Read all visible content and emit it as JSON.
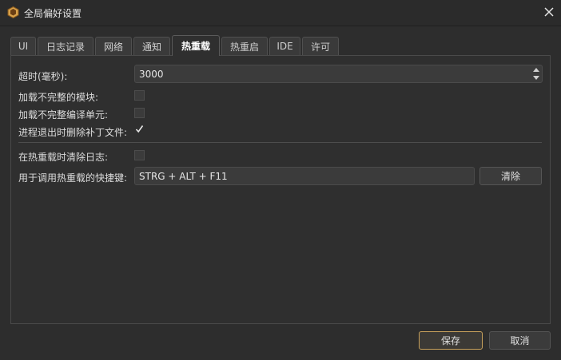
{
  "window": {
    "title": "全局偏好设置"
  },
  "tabs": [
    {
      "label": "UI",
      "active": false
    },
    {
      "label": "日志记录",
      "active": false
    },
    {
      "label": "网络",
      "active": false
    },
    {
      "label": "通知",
      "active": false
    },
    {
      "label": "热重载",
      "active": true
    },
    {
      "label": "热重启",
      "active": false
    },
    {
      "label": "IDE",
      "active": false
    },
    {
      "label": "许可",
      "active": false
    }
  ],
  "settings": {
    "timeout": {
      "label": "超时(毫秒):",
      "value": "3000"
    },
    "load_incomplete_modules": {
      "label": "加载不完整的模块:",
      "checked": false
    },
    "load_incomplete_units": {
      "label": "加载不完整编译单元:",
      "checked": false
    },
    "delete_patch_on_exit": {
      "label": "进程退出时删除补丁文件:",
      "checked": true
    },
    "clear_log_on_reload": {
      "label": "在热重载时清除日志:",
      "checked": false
    },
    "shortcut": {
      "label": "用于调用热重载的快捷键:",
      "value": "STRG + ALT + F11",
      "clear_label": "清除"
    }
  },
  "footer": {
    "save_label": "保存",
    "cancel_label": "取消"
  },
  "colors": {
    "accent": "#c9a25c",
    "background": "#2d2d2d"
  },
  "icons": {
    "app": "app-logo-icon",
    "close": "close-icon",
    "check": "checkmark-icon"
  }
}
